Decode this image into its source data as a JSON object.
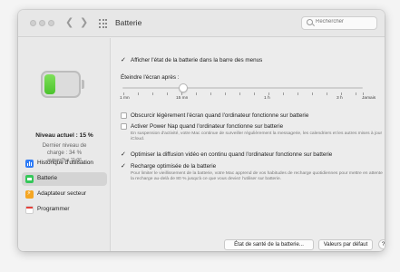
{
  "window": {
    "title": "Batterie"
  },
  "search": {
    "placeholder": "Rechercher"
  },
  "sidebar": {
    "level_now": "Niveau actuel : 15 %",
    "last_charge": "Dernier niveau de charge : 34 %",
    "last_charge_date": "aujourd'hui 11:06",
    "battery_fill_fraction": 0.34,
    "items": [
      {
        "label": "Historique d'utilisation",
        "icon": "usage-history-icon",
        "selected": false
      },
      {
        "label": "Batterie",
        "icon": "battery-icon",
        "selected": true
      },
      {
        "label": "Adaptateur secteur",
        "icon": "power-adapter-icon",
        "selected": false
      },
      {
        "label": "Programmer",
        "icon": "schedule-icon",
        "selected": false
      }
    ]
  },
  "main": {
    "show_status": {
      "label": "Afficher l'état de la batterie dans la barre des menus",
      "checked": true
    },
    "display_off": {
      "label": "Éteindre l'écran après :",
      "ticks": [
        "1 mn",
        "15 mn",
        "1 h",
        "3 h",
        "Jamais"
      ],
      "value": "15 mn"
    },
    "dim_display": {
      "label": "Obscurcir légèrement l'écran quand l'ordinateur fonctionne sur batterie",
      "checked": false
    },
    "power_nap": {
      "label": "Activer Power Nap quand l'ordinateur fonctionne sur batterie",
      "checked": false,
      "description": "En suspension d'activité, votre Mac continue de surveiller régulièrement la messagerie, les calendriers et les autres mises à jour iCloud."
    },
    "optimize_video": {
      "label": "Optimiser la diffusion vidéo en continu quand l'ordinateur fonctionne sur batterie",
      "checked": true
    },
    "optimized_charging": {
      "label": "Recharge optimisée de la batterie",
      "checked": true,
      "description": "Pour limiter le vieillissement de la batterie, votre Mac apprend de vos habitudes de recharge quotidiennes pour mettre en attente la recharge au-delà de 80 % jusqu'à ce que vous deviez l'utiliser sur batterie."
    },
    "buttons": {
      "health": "État de santé de la batterie...",
      "defaults": "Valeurs par défaut",
      "help": "?"
    }
  },
  "colors": {
    "battery_green": "#4bc32d",
    "selected_item_bg": "#d4d4d4"
  }
}
